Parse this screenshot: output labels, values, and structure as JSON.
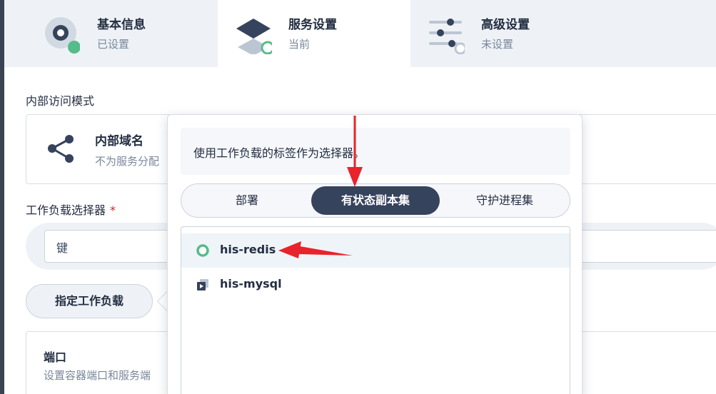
{
  "steps": [
    {
      "title": "基本信息",
      "status": "已设置",
      "icon": "gear-circle-icon"
    },
    {
      "title": "服务设置",
      "status": "当前",
      "icon": "layers-icon"
    },
    {
      "title": "高级设置",
      "status": "未设置",
      "icon": "sliders-icon"
    }
  ],
  "form": {
    "access_mode_label": "内部访问模式",
    "access_card": {
      "title": "内部域名",
      "desc": "不为服务分配"
    },
    "selector_label": "工作负载选择器",
    "required_mark": "*",
    "key_placeholder": "键",
    "assign_button": "指定工作负载",
    "ports": {
      "title": "端口",
      "desc": "设置容器端口和服务端"
    }
  },
  "popover": {
    "hint": "使用工作负载的标签作为选择器。",
    "tabs": [
      "部署",
      "有状态副本集",
      "守护进程集"
    ],
    "active_tab": 1,
    "items": [
      {
        "label": "his-redis",
        "icon": "status-ring-icon"
      },
      {
        "label": "his-mysql",
        "icon": "workload-icon"
      }
    ]
  },
  "colors": {
    "accent": "#36435c",
    "success": "#55bc8a",
    "annotation": "#e8232b"
  }
}
